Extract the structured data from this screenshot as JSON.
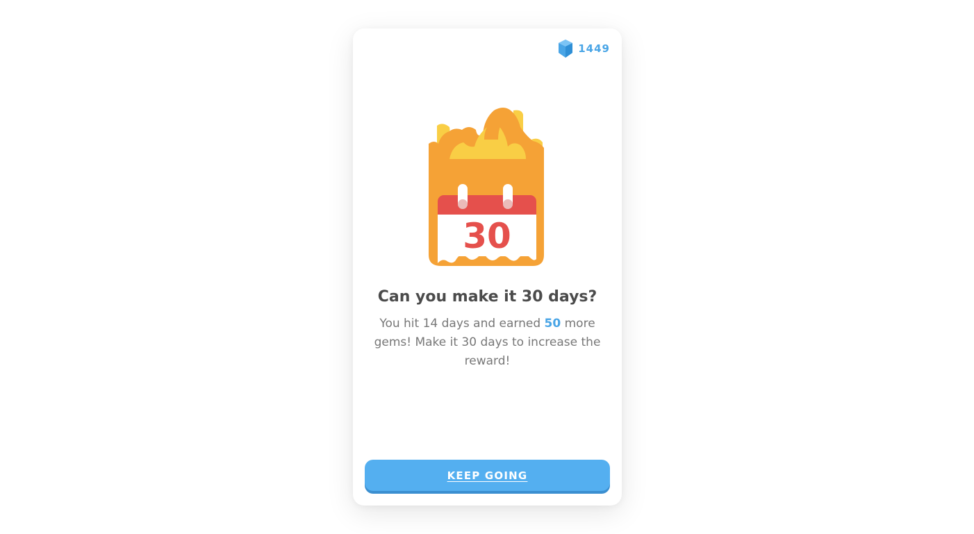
{
  "gems": {
    "icon": "gem-icon",
    "count": "1449",
    "color": "#49a5e6"
  },
  "illustration": {
    "icon": "calendar-on-fire-icon",
    "calendar_number": "30",
    "colors": {
      "flame_orange": "#f5a236",
      "flame_yellow": "#f9ce45",
      "calendar_header": "#e5504c"
    }
  },
  "prompt": {
    "title": "Can you make it 30 days?",
    "body_part1": "You hit 14 days and earned ",
    "body_highlight": "50",
    "body_part2": " more gems! Make it 30 days to increase the reward!"
  },
  "actions": {
    "keep_going_label": "KEEP GOING",
    "button_color": "#54aff0"
  }
}
